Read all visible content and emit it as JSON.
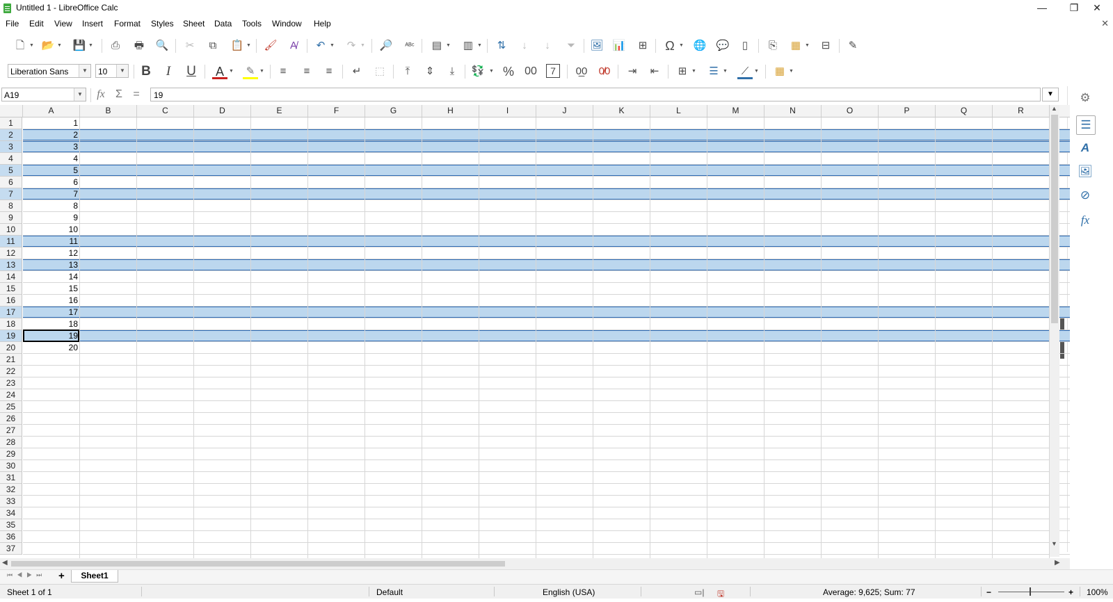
{
  "window": {
    "title": "Untitled 1 - LibreOffice Calc",
    "min": "—",
    "max": "❐",
    "close": "✕"
  },
  "menu": [
    "File",
    "Edit",
    "View",
    "Insert",
    "Format",
    "Styles",
    "Sheet",
    "Data",
    "Tools",
    "Window",
    "Help"
  ],
  "format_toolbar": {
    "font_name": "Liberation Sans",
    "font_size": "10",
    "bold": "B",
    "italic": "I",
    "underline": "U",
    "percent": "%",
    "zeros": "00",
    "date": "7",
    "add_decimal": "0̲0",
    "del_decimal": "0̸0"
  },
  "formula_bar": {
    "name_box": "A19",
    "fx": "fx",
    "sum": "Σ",
    "equals": "=",
    "content": "19"
  },
  "columns": [
    "A",
    "B",
    "C",
    "D",
    "E",
    "F",
    "G",
    "H",
    "I",
    "J",
    "K",
    "L",
    "M",
    "N",
    "O",
    "P",
    "Q",
    "R"
  ],
  "rows": [
    "1",
    "2",
    "3",
    "4",
    "5",
    "6",
    "7",
    "8",
    "9",
    "10",
    "11",
    "12",
    "13",
    "14",
    "15",
    "16",
    "17",
    "18",
    "19",
    "20",
    "21",
    "22",
    "23",
    "24",
    "25",
    "26",
    "27",
    "28",
    "29",
    "30",
    "31",
    "32",
    "33",
    "34",
    "35",
    "36",
    "37"
  ],
  "column_a_values": [
    "1",
    "2",
    "3",
    "4",
    "5",
    "6",
    "7",
    "8",
    "9",
    "10",
    "11",
    "12",
    "13",
    "14",
    "15",
    "16",
    "17",
    "18",
    "19",
    "20"
  ],
  "selected_rows": [
    2,
    3,
    5,
    7,
    11,
    13,
    17,
    19
  ],
  "active_cell": "A19",
  "sheet_tabs": {
    "add": "+",
    "current": "Sheet1"
  },
  "status": {
    "sheet_info": "Sheet 1 of 1",
    "page_style": "Default",
    "language": "English (USA)",
    "summary": "Average: 9,625; Sum: 77",
    "zoom": "100%"
  },
  "colors": {
    "selection_fill": "#bcd7ee",
    "selection_border": "#2d6bb5",
    "header_bg": "#f3f3f3"
  }
}
